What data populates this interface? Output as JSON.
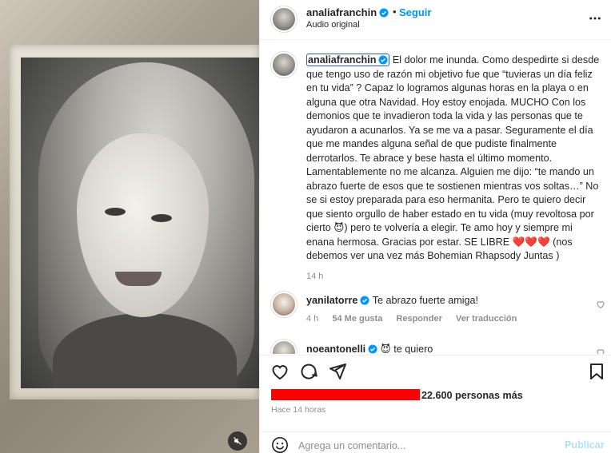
{
  "header": {
    "username": "analiafranchin",
    "follow_label": "Seguir",
    "dot": "•",
    "subtitle": "Audio original"
  },
  "caption": {
    "username": "analiafranchin",
    "text": "El dolor me inunda. Como despedirte si desde que tengo uso de razón mi objetivo fue que “tuvieras un día feliz en tu vida” ? Capaz lo logramos algunas horas en la playa o en alguna que otra Navidad. Hoy estoy enojada. MUCHO Con los demonios que te invadieron toda la vida y las personas que te ayudaron a acunarlos. Ya se me va a pasar. Seguramente el día que me mandes alguna señal de que pudiste finalmente derrotarlos. Te abrace y bese hasta el último momento. Lamentablemente no me alcanza. Alguien me dijo: “te mando un abrazo fuerte de esos que te sostienen mientras vos soltas…” No se si estoy preparada para eso hermanita. Pero te quiero decir que siento orgullo de haber estado en tu vida (muy revoltosa por cierto 😈) pero te volvería a elegir. Te amo hoy y siempre mi enana hermosa. Gracias por estar. SE LIBRE ❤️❤️❤️ (nos debemos ver una vez más Bohemian Rhapsody Juntas )",
    "time": "14 h"
  },
  "comments": [
    {
      "username": "yanilatorre",
      "text": "Te abrazo fuerte amiga!",
      "time": "4 h",
      "likes": "54 Me gusta",
      "reply_label": "Responder",
      "translate_label": "Ver traducción"
    },
    {
      "username": "noeantonelli",
      "text": "😈 te quiero"
    }
  ],
  "footer": {
    "likes_text": "22.600 personas más",
    "time_ago": "Hace 14 horas",
    "comment_placeholder": "Agrega un comentario...",
    "publish_label": "Publicar"
  },
  "colors": {
    "accent": "#0095f6",
    "verified": "#0095f6",
    "redaction": "#ff0000",
    "publish_disabled": "#b2dffc"
  },
  "icons": [
    "verified-badge-icon",
    "more-options-icon",
    "heart-icon",
    "comment-icon",
    "share-icon",
    "bookmark-icon",
    "emoji-icon",
    "mute-icon"
  ]
}
